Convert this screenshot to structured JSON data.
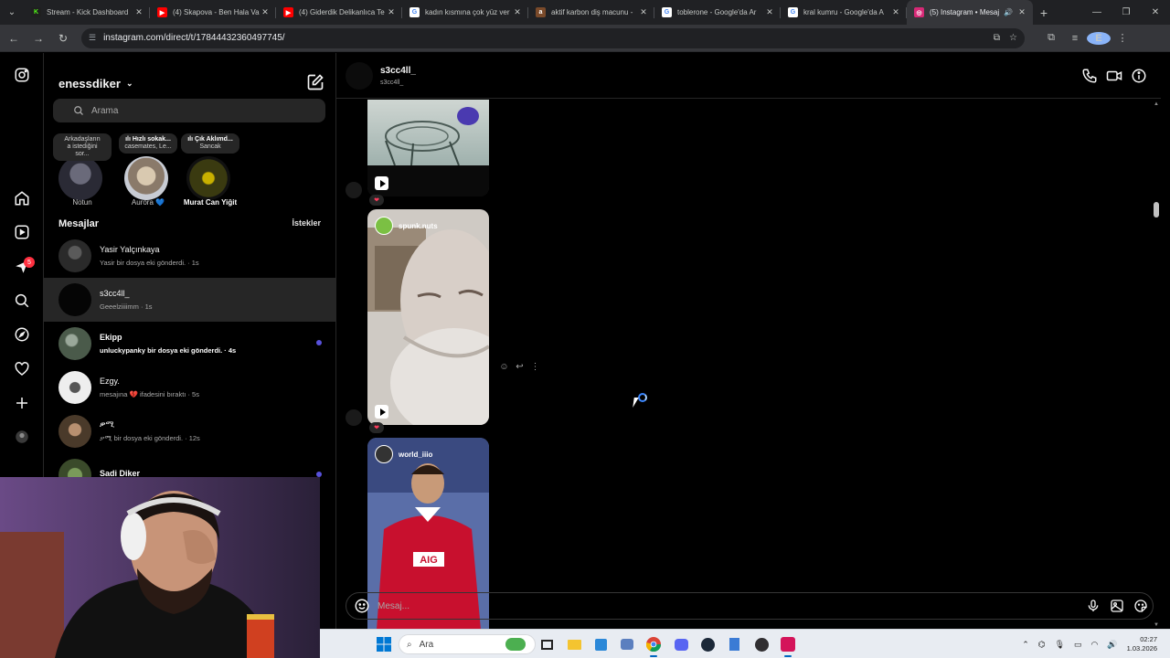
{
  "browser": {
    "tabs": [
      {
        "title": "Stream - Kick Dashboard",
        "fav_color": "#1f1f1f",
        "fav_glyph": "K",
        "fav_text_color": "#53fc18",
        "active": false
      },
      {
        "title": "(4) Skapova - Ben Hala Va",
        "fav_color": "#ff0000",
        "fav_glyph": "▶",
        "fav_text_color": "#ffffff",
        "active": false
      },
      {
        "title": "(4) Giderdik Delikanlıca Te",
        "fav_color": "#ff0000",
        "fav_glyph": "▶",
        "fav_text_color": "#ffffff",
        "active": false
      },
      {
        "title": "kadın kısmına çok yüz ver",
        "fav_color": "#ffffff",
        "fav_glyph": "G",
        "fav_text_color": "#4285f4",
        "active": false
      },
      {
        "title": "aktif karbon diş macunu -",
        "fav_color": "#7a4a2a",
        "fav_glyph": "a",
        "fav_text_color": "#ffffff",
        "active": false
      },
      {
        "title": "toblerone - Google'da Ar",
        "fav_color": "#ffffff",
        "fav_glyph": "G",
        "fav_text_color": "#4285f4",
        "active": false
      },
      {
        "title": "kral kumru - Google'da A",
        "fav_color": "#ffffff",
        "fav_glyph": "G",
        "fav_text_color": "#4285f4",
        "active": false
      },
      {
        "title": "(5) Instagram • Mesaj",
        "fav_color": "#d62976",
        "fav_glyph": "◎",
        "fav_text_color": "#ffffff",
        "active": true
      }
    ],
    "new_tab": "+",
    "url": "instagram.com/direct/t/17844432360497745/",
    "profile_initial": "E"
  },
  "instagram": {
    "username": "enessdiker",
    "search_placeholder": "Arama",
    "notes": [
      {
        "bubble_line1": "Arkadaşların",
        "bubble_line2": "a istediğini",
        "bubble_line3": "sor...",
        "name": "Notun",
        "bold": false
      },
      {
        "bubble_line1": "ılı Hızlı sokak...",
        "bubble_line2": "casemates, Le...",
        "bubble_line3": "",
        "name": "Aurora 💙",
        "bold": false
      },
      {
        "bubble_line1": "ılı Çık Aklımd...",
        "bubble_line2": "Sancak",
        "bubble_line3": "",
        "name": "Murat Can Yiğit",
        "bold": true
      }
    ],
    "messages_header": "Mesajlar",
    "requests_label": "İstekler",
    "unread_badge": "5",
    "threads": [
      {
        "name": "Yasir Yalçınkaya",
        "preview": "Yasir bir dosya eki gönderdi. · 1s",
        "unread": false,
        "selected": false,
        "avatar": "#3a3a3a"
      },
      {
        "name": "s3cc4ll_",
        "preview": "Geeelziiiimm · 1s",
        "unread": false,
        "selected": true,
        "avatar": "#050505"
      },
      {
        "name": "Ekipp",
        "preview": "unluckypanky bir dosya eki gönderdi. · 4s",
        "unread": true,
        "selected": false,
        "avatar": "#5a6a5a"
      },
      {
        "name": "Ezgy.",
        "preview": "mesajına 💔 ifadesini bıraktı · 5s",
        "unread": false,
        "selected": false,
        "avatar": "#e8e8e8"
      },
      {
        "name": "ቃሚ",
        "preview": "ቃሚ bir dosya eki gönderdi. · 12s",
        "unread": false,
        "selected": false,
        "avatar": "#7a5a3a"
      },
      {
        "name": "Sadi Diker",
        "preview": "",
        "unread": true,
        "selected": false,
        "avatar": "#4a6a3a"
      }
    ],
    "chat": {
      "name": "s3cc4ll_",
      "handle": "s3cc4ll_",
      "shared_posts": [
        {
          "owner": ""
        },
        {
          "owner": "spunk.nuts"
        },
        {
          "owner": "world_iiio"
        }
      ],
      "reaction": "❤",
      "composer_placeholder": "Mesaj..."
    }
  },
  "taskbar": {
    "search_placeholder": "Ara",
    "time": "02:27",
    "date": "1.03.2026"
  },
  "colors": {
    "ig_bg": "#000000",
    "accent_unread": "#5851db",
    "badge": "#ff3040"
  }
}
